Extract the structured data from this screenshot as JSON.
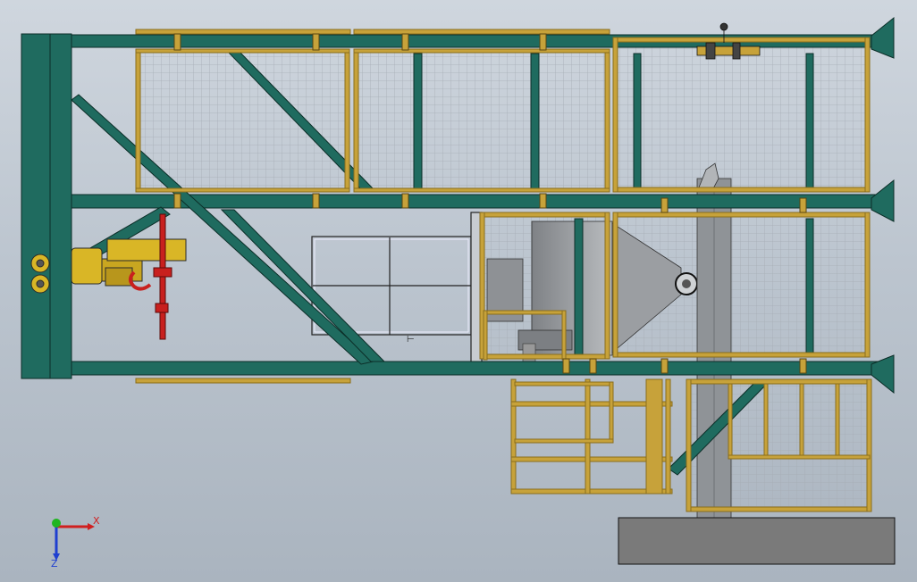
{
  "viewport": {
    "view": "top-orientation",
    "background_top": "#cfd6de",
    "background_bottom": "#aab4bf"
  },
  "colors": {
    "steel": "#1f6b5f",
    "steel_dark": "#134a41",
    "handrail": "#c7a23a",
    "handrail_dark": "#8a6d1c",
    "mesh": "#a9b0b8",
    "hopper": "#8c8f93",
    "hopper_light": "#b5b8bb",
    "hoist": "#d9b626",
    "hook": "#c8201e",
    "base": "#7a7a7a"
  },
  "triad": {
    "x_label": "X",
    "z_label": "Z",
    "x_color": "#d01f1f",
    "y_color": "#1fb51f",
    "z_color": "#1f3fd0"
  }
}
